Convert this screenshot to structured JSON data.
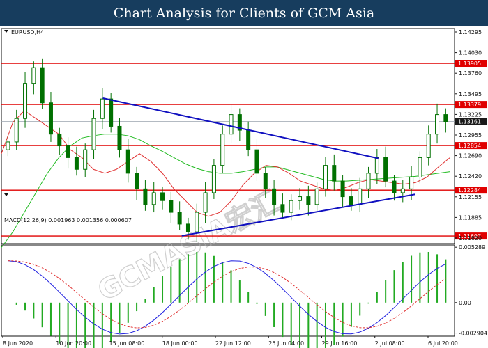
{
  "banner": {
    "title": "Chart Analysis for Clients of GCM Asia"
  },
  "chart_data": {
    "type": "candlestick",
    "symbol": "EURUSD,H4",
    "price_axis": {
      "ticks": [
        "1.14295",
        "1.14030",
        "1.13760",
        "1.13495",
        "1.13225",
        "1.12955",
        "1.12690",
        "1.12420",
        "1.12155",
        "1.11885",
        "1.11620"
      ]
    },
    "current_price": "1.13161",
    "horizontal_levels": [
      {
        "label": "1.13905",
        "value": 1.13905
      },
      {
        "label": "1.13379",
        "value": 1.13379
      },
      {
        "label": "1.12854",
        "value": 1.12854
      },
      {
        "label": "1.12284",
        "value": 1.12284
      },
      {
        "label": "1.11697",
        "value": 1.11697
      }
    ],
    "price_ylim": [
      1.116,
      1.1435
    ],
    "trendlines": [
      {
        "name": "descending",
        "from": [
          0.224,
          1.1346
        ],
        "to": [
          0.832,
          1.1269
        ]
      },
      {
        "name": "ascending",
        "from": [
          0.398,
          1.117
        ],
        "to": [
          0.913,
          1.1223
        ]
      }
    ],
    "sma_red": [
      1.1275,
      1.1315,
      1.133,
      1.132,
      1.131,
      1.13,
      1.128,
      1.127,
      1.1255,
      1.125,
      1.1255,
      1.1265,
      1.1275,
      1.1265,
      1.125,
      1.123,
      1.1215,
      1.12,
      1.1195,
      1.12,
      1.1215,
      1.1235,
      1.125,
      1.126,
      1.1258,
      1.125,
      1.124,
      1.1235,
      1.123,
      1.1228,
      1.1232,
      1.1238,
      1.1242,
      1.124,
      1.1238,
      1.1236,
      1.1238,
      1.1245,
      1.1258,
      1.127
    ],
    "sma_green": [
      1.1155,
      1.1175,
      1.12,
      1.1225,
      1.125,
      1.127,
      1.1285,
      1.1295,
      1.1298,
      1.13,
      1.13,
      1.1298,
      1.1293,
      1.1285,
      1.1278,
      1.127,
      1.1262,
      1.1256,
      1.1252,
      1.125,
      1.125,
      1.1252,
      1.1255,
      1.1258,
      1.1258,
      1.1254,
      1.125,
      1.1246,
      1.1242,
      1.124,
      1.124,
      1.1241,
      1.1242,
      1.1243,
      1.1244,
      1.1245,
      1.1246,
      1.1248,
      1.125,
      1.1252
    ],
    "candles_close": [
      1.129,
      1.132,
      1.1365,
      1.1385,
      1.134,
      1.13,
      1.1285,
      1.127,
      1.1255,
      1.128,
      1.132,
      1.1345,
      1.131,
      1.128,
      1.125,
      1.123,
      1.121,
      1.1225,
      1.1215,
      1.12,
      1.1185,
      1.1175,
      1.12,
      1.1225,
      1.126,
      1.13,
      1.1325,
      1.1305,
      1.128,
      1.125,
      1.123,
      1.121,
      1.12,
      1.1215,
      1.122,
      1.121,
      1.123,
      1.126,
      1.124,
      1.122,
      1.121,
      1.123,
      1.125,
      1.127,
      1.124,
      1.1225,
      1.123,
      1.1245,
      1.127,
      1.13,
      1.1325,
      1.1316
    ],
    "macd": {
      "label": "MACD(12,26,9) 0.001963 0.001356 0.000607",
      "ticks": [
        "0.005289",
        "0.00",
        "-0.002904"
      ],
      "ylim": [
        -0.0032,
        0.0055
      ]
    },
    "time_axis": {
      "ticks": [
        "8 Jun 2020",
        "10 Jun 20:00",
        "15 Jun 08:00",
        "18 Jun 00:00",
        "22 Jun 12:00",
        "25 Jun 04:00",
        "29 Jun 16:00",
        "2 Jul 08:00",
        "6 Jul 20:00"
      ]
    },
    "watermark": "GCMASIA宏汇",
    "colors": {
      "level_line": "#e00000",
      "trendline": "#1010c0",
      "sma_red": "#e03030",
      "sma_green": "#22bb22",
      "macd_line": "#2020e0",
      "signal_line": "#e03030",
      "histogram": "#22aa22",
      "candle": "#007000",
      "badge": "#e00000",
      "current_badge": "#1a1a1a"
    }
  }
}
